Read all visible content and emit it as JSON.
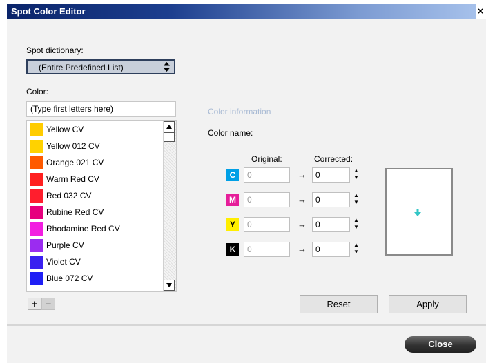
{
  "window": {
    "title": "Spot Color Editor",
    "close_glyph": "×"
  },
  "dictionary": {
    "label": "Spot dictionary:",
    "selected": "(Entire Predefined List)",
    "arrow_icon": "up-down-arrows-icon"
  },
  "color_search": {
    "label": "Color:",
    "value": "(Type first letters here)"
  },
  "color_list": {
    "items": [
      {
        "label": "Yellow CV",
        "color": "#ffcc00"
      },
      {
        "label": "Yellow 012 CV",
        "color": "#ffd200"
      },
      {
        "label": "Orange 021 CV",
        "color": "#ff5a00"
      },
      {
        "label": "Warm Red CV",
        "color": "#ff2020"
      },
      {
        "label": "Red 032 CV",
        "color": "#ff1e2d"
      },
      {
        "label": "Rubine Red CV",
        "color": "#e6007e"
      },
      {
        "label": "Rhodamine Red CV",
        "color": "#f21ee1"
      },
      {
        "label": "Purple CV",
        "color": "#9b2cf0"
      },
      {
        "label": "Violet CV",
        "color": "#3a20f0"
      },
      {
        "label": "Blue 072 CV",
        "color": "#1f1ff5"
      }
    ],
    "scroll_up_icon": "scroll-up-arrow-icon",
    "scroll_down_icon": "scroll-down-arrow-icon"
  },
  "list_buttons": {
    "add": "+",
    "remove": "−"
  },
  "color_info": {
    "group_title": "Color information",
    "name_label": "Color name:",
    "original_header": "Original:",
    "corrected_header": "Corrected:",
    "arrow_glyph": "→",
    "channels": [
      {
        "letter": "C",
        "color": "#00a0e6",
        "original": "0",
        "corrected": "0"
      },
      {
        "letter": "M",
        "color": "#e61e9a",
        "original": "0",
        "corrected": "0"
      },
      {
        "letter": "Y",
        "color": "#ffee00",
        "original": "0",
        "corrected": "0"
      },
      {
        "letter": "K",
        "color": "#000000",
        "original": "0",
        "corrected": "0"
      }
    ],
    "preview_icon": "down-arrow-icon"
  },
  "buttons": {
    "reset": "Reset",
    "apply": "Apply",
    "close": "Close"
  }
}
